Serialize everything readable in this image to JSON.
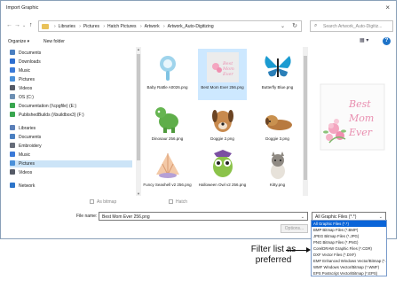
{
  "window": {
    "title": "Import Graphic",
    "close_glyph": "×"
  },
  "nav": {
    "back": "←",
    "forward": "→",
    "dropdown": "⌄",
    "up": "↑"
  },
  "address": {
    "crumbs": [
      "Libraries",
      "Pictures",
      "Hatch Pictures",
      "Artwork",
      "Artwork_Auto-Digitizing"
    ],
    "dropdown_glyph": "⌄",
    "refresh_glyph": "↻"
  },
  "search": {
    "placeholder": "Search Artwork_Auto-Digitiz..."
  },
  "toolbar": {
    "organize": "Organize ▾",
    "new_folder": "New folder",
    "view_glyph": "▦ ▾",
    "help_glyph": "?"
  },
  "sidebar": {
    "items": [
      {
        "label": "Documents",
        "icon": "documents-icon",
        "color": "#4a7fc1"
      },
      {
        "label": "Downloads",
        "icon": "downloads-icon",
        "color": "#2e6fd1"
      },
      {
        "label": "Music",
        "icon": "music-icon",
        "color": "#3b7ad8"
      },
      {
        "label": "Pictures",
        "icon": "pictures-icon",
        "color": "#4a90d9"
      },
      {
        "label": "Videos",
        "icon": "videos-icon",
        "color": "#555a66"
      },
      {
        "label": "OS (C:)",
        "icon": "drive-icon",
        "color": "#6d8fb3"
      },
      {
        "label": "Documentation (\\\\cpgfile) (E:)",
        "icon": "network-drive-icon",
        "color": "#39a64f"
      },
      {
        "label": "PublishedBuilds (\\\\buildbox3) (F:)",
        "icon": "network-drive-icon",
        "color": "#39a64f"
      },
      {
        "label": "Libraries",
        "icon": "libraries-icon",
        "color": "#5b7fb8"
      },
      {
        "label": "Documents",
        "icon": "documents-icon",
        "color": "#4a7fc1"
      },
      {
        "label": "Embroidery",
        "icon": "embroidery-icon",
        "color": "#666c79"
      },
      {
        "label": "Music",
        "icon": "music-icon",
        "color": "#3b7ad8"
      },
      {
        "label": "Pictures",
        "icon": "pictures-icon",
        "color": "#4a90d9",
        "selected": true
      },
      {
        "label": "Videos",
        "icon": "videos-icon",
        "color": "#555a66"
      },
      {
        "label": "Network",
        "icon": "network-icon",
        "color": "#2c74c9"
      }
    ],
    "scroll_up": "▲",
    "scroll_down": "▼"
  },
  "files": [
    {
      "name": "Baby Rattle A0026.png",
      "icon": "baby-rattle-thumbnail"
    },
    {
      "name": "Best Mom Ever 256.png",
      "icon": "best-mom-ever-thumbnail",
      "selected": true
    },
    {
      "name": "Butterfly Blue.png",
      "icon": "butterfly-thumbnail"
    },
    {
      "name": "Dinosaur 256.png",
      "icon": "dinosaur-thumbnail"
    },
    {
      "name": "Doggie 2.png",
      "icon": "doggie-2-thumbnail"
    },
    {
      "name": "Doggie 3.png",
      "icon": "doggie-3-thumbnail"
    },
    {
      "name": "Funcy Seashell v2 256.png",
      "icon": "seashell-thumbnail"
    },
    {
      "name": "Halloween Owl v2 256.png",
      "icon": "owl-thumbnail"
    },
    {
      "name": "Kitty.png",
      "icon": "kitty-thumbnail"
    }
  ],
  "preview": {
    "text": "Best Mom Ever"
  },
  "options": {
    "as_bitmap": "As bitmap",
    "hatch": "Hatch"
  },
  "filename": {
    "label": "File name:",
    "value": "Best Mom Ever 256.png",
    "dropdown_glyph": "⌄"
  },
  "filter": {
    "value": "All Graphic Files (*.*)",
    "dropdown_glyph": "⌄"
  },
  "options_button": "Options...",
  "filter_list": [
    {
      "label": "All Graphic Files (*.*)",
      "selected": true
    },
    {
      "label": "BMP Bitmap Files (*.BMP)"
    },
    {
      "label": "JPEG Bitmap Files (*.JPG)"
    },
    {
      "label": "PNG Bitmap Files (*.PNG)"
    },
    {
      "label": "CorelDRAW Graphic Files (*.CDR)"
    },
    {
      "label": "DXF Vector Files (*.DXF)"
    },
    {
      "label": "EMF Enhanced Windows Vector/Bitmap (*.EMF)"
    },
    {
      "label": "WMF Windows Vector/Bitmap (*.WMF)"
    },
    {
      "label": "EPS Postscript Vector/Bitmap (*.EPS)"
    }
  ],
  "callout": {
    "line1": "Filter list as",
    "line2": "preferred"
  },
  "colors": {
    "selection": "#0a64d8",
    "tile_selected": "#cde8ff",
    "accent": "#1e73c8"
  }
}
